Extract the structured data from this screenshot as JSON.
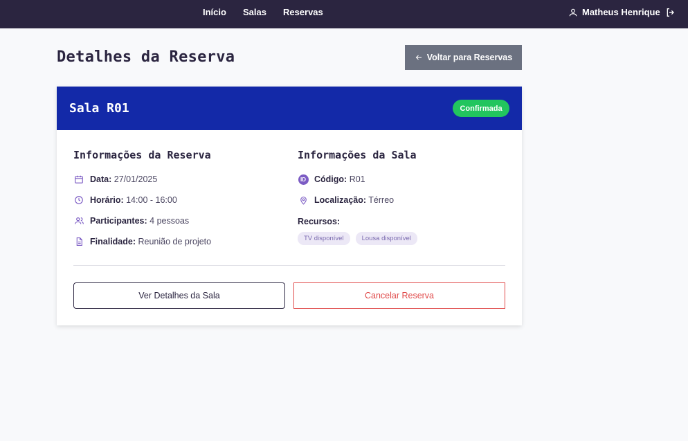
{
  "nav": {
    "items": [
      "Início",
      "Salas",
      "Reservas"
    ]
  },
  "user": {
    "name": "Matheus Henrique"
  },
  "page": {
    "title": "Detalhes da Reserva",
    "back_label": "Voltar para Reservas"
  },
  "room": {
    "name": "Sala R01",
    "status": "Confirmada"
  },
  "booking": {
    "section_title": "Informações da Reserva",
    "date_label": "Data:",
    "date": "27/01/2025",
    "time_label": "Horário:",
    "time": "14:00 - 16:00",
    "participants_label": "Participantes:",
    "participants": "4 pessoas",
    "purpose_label": "Finalidade:",
    "purpose": "Reunião de projeto"
  },
  "room_info": {
    "section_title": "Informações da Sala",
    "id_icon": "ID",
    "code_label": "Código:",
    "code": "R01",
    "location_label": "Localização:",
    "location": "Térreo",
    "resources_label": "Recursos:",
    "resources": [
      "TV disponível",
      "Lousa disponível"
    ]
  },
  "actions": {
    "details_label": "Ver Detalhes da Sala",
    "cancel_label": "Cancelar Reserva"
  },
  "colors": {
    "topbar": "#2b2540",
    "header": "#1329a8",
    "confirmed": "#22c55e",
    "danger": "#e04a4a",
    "accent": "#7c5cc4"
  }
}
